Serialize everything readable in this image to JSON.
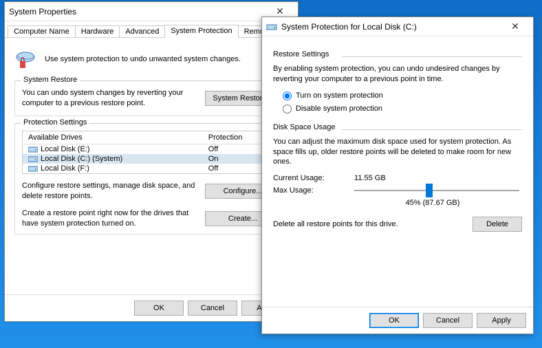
{
  "props": {
    "title": "System Properties",
    "tabs": [
      "Computer Name",
      "Hardware",
      "Advanced",
      "System Protection",
      "Remote"
    ],
    "active_tab": 3,
    "intro": "Use system protection to undo unwanted system changes.",
    "restore": {
      "legend": "System Restore",
      "desc": "You can undo system changes by reverting your computer to a previous restore point.",
      "button": "System Restore..."
    },
    "settings": {
      "legend": "Protection Settings",
      "cols": [
        "Available Drives",
        "Protection"
      ],
      "rows": [
        {
          "name": "Local Disk (E:)",
          "prot": "Off"
        },
        {
          "name": "Local Disk (C:) (System)",
          "prot": "On"
        },
        {
          "name": "Local Disk (F:)",
          "prot": "Off"
        }
      ],
      "selected": 1,
      "configure_desc": "Configure restore settings, manage disk space, and delete restore points.",
      "configure_btn": "Configure...",
      "create_desc": "Create a restore point right now for the drives that have system protection turned on.",
      "create_btn": "Create..."
    },
    "buttons": {
      "ok": "OK",
      "cancel": "Cancel",
      "apply": "Apply"
    }
  },
  "prot": {
    "title": "System Protection for Local Disk (C:)",
    "restore": {
      "legend": "Restore Settings",
      "desc": "By enabling system protection, you can undo undesired changes by reverting your computer to a previous point in time.",
      "opt_on": "Turn on system protection",
      "opt_off": "Disable system protection",
      "selected": "on"
    },
    "usage": {
      "legend": "Disk Space Usage",
      "desc": "You can adjust the maximum disk space used for system protection. As space fills up, older restore points will be deleted to make room for new ones.",
      "current_label": "Current Usage:",
      "current_val": "11.55 GB",
      "max_label": "Max Usage:",
      "slider_percent": 45,
      "slider_display": "45% (87.67 GB)",
      "delete_desc": "Delete all restore points for this drive.",
      "delete_btn": "Delete"
    },
    "buttons": {
      "ok": "OK",
      "cancel": "Cancel",
      "apply": "Apply"
    }
  }
}
